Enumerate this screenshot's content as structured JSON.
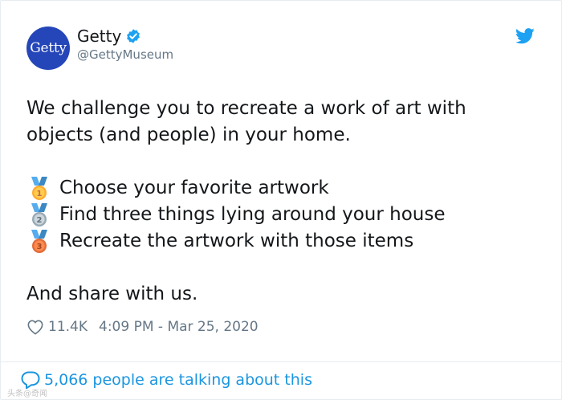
{
  "author": {
    "avatar_text": "Getty",
    "display_name": "Getty",
    "handle": "@GettyMuseum",
    "verified_icon": "verified-badge-icon"
  },
  "tweet": {
    "lines": [
      "We challenge you to recreate a work of art with",
      "objects (and people) in your home."
    ],
    "steps": [
      {
        "medal": "gold-medal-1",
        "text": "Choose your favorite artwork"
      },
      {
        "medal": "silver-medal-2",
        "text": "Find three things lying around your house"
      },
      {
        "medal": "bronze-medal-3",
        "text": "Recreate the artwork with those items"
      }
    ],
    "closing": "And share with us."
  },
  "meta": {
    "likes": "11.4K",
    "timestamp": "4:09 PM - Mar 25, 2020"
  },
  "footer": {
    "talking_text": "5,066 people are talking about this"
  },
  "watermark": "头条@奇闻",
  "colors": {
    "avatar_bg": "#2446b8",
    "twitter_blue": "#1da1f2",
    "link_blue": "#1b95e0",
    "muted": "#657786",
    "text": "#14171a"
  }
}
